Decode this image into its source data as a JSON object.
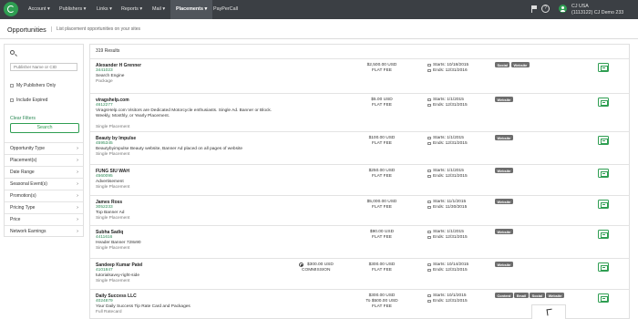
{
  "nav": {
    "items": [
      {
        "label": "Account ▾"
      },
      {
        "label": "Publishers ▾"
      },
      {
        "label": "Links ▾"
      },
      {
        "label": "Reports ▾"
      },
      {
        "label": "Mail ▾"
      },
      {
        "label": "Placements ▾"
      },
      {
        "label": "PayPerCall"
      }
    ],
    "help_glyph": "?",
    "user_name": "CJ USA",
    "user_account": "(1113122) CJ Demo 233"
  },
  "header": {
    "title": "Opportunities",
    "subtitle": "List placement opportunities on your sites"
  },
  "sidebar": {
    "search_placeholder": "Publisher Name or CID",
    "my_publishers_label": "My Publishers Only",
    "include_expired_label": "Include Expired",
    "clear_filters_label": "Clear Filters",
    "search_button_label": "Search",
    "chevron_glyph": "›",
    "filters": [
      {
        "label": "Opportunity Type"
      },
      {
        "label": "Placement(s)"
      },
      {
        "label": "Date Range"
      },
      {
        "label": "Seasonal Event(s)"
      },
      {
        "label": "Promotion(s)"
      },
      {
        "label": "Pricing Type"
      },
      {
        "label": "Price"
      },
      {
        "label": "Network Earnings"
      }
    ]
  },
  "results": {
    "count_label": "319 Results",
    "rows": [
      {
        "name": "Alexander H Grenner",
        "id": "3441023",
        "desc": "Search Engine",
        "type": "Package",
        "amount": "$2,500.00 USD",
        "fee": "FLAT FEE",
        "starts": "Starts: 10/18/2015",
        "ends": "Ends: 12/31/2016",
        "tags": [
          "Social",
          "Website"
        ]
      },
      {
        "name": "viragshelp.com",
        "id": "4612277",
        "desc": "ViragsHelp.com Visitors are Dedicated Motorcycle enthusiasts. Single Ad. Banner or Block. Weekly, Monthly, or Yearly Placement.",
        "type": "Single Placement",
        "amount": "$5.00 USD",
        "fee": "FLAT FEE",
        "starts": "Starts: 1/1/2015",
        "ends": "Ends: 12/31/2015",
        "tags": [
          "Website"
        ]
      },
      {
        "name": "Beauty by Impulse",
        "id": "4595345",
        "desc": "Beautybyimpulse Beauty website, Banner Ad placed on all pages of website",
        "type": "Single Placement",
        "amount": "$100.00 USD",
        "fee": "FLAT FEE",
        "starts": "Starts: 1/1/2015",
        "ends": "Ends: 12/31/2015",
        "tags": [
          "Website"
        ]
      },
      {
        "name": "FUNG SIU WAH",
        "id": "4560095",
        "desc": "Advertisement",
        "type": "Single Placement",
        "amount": "$250.00 USD",
        "fee": "FLAT FEE",
        "starts": "Starts: 1/1/2015",
        "ends": "Ends: 12/31/2015",
        "tags": [
          "Website"
        ]
      },
      {
        "name": "James Ross",
        "id": "3052233",
        "desc": "Top Banner Ad",
        "type": "Single Placement",
        "amount": "$5,000.00 USD",
        "fee": "FLAT FEE",
        "starts": "Starts: 11/1/2015",
        "ends": "Ends: 11/30/2015",
        "tags": [
          "Website"
        ]
      },
      {
        "name": "Subha Sadiq",
        "id": "4411616",
        "desc": "Header Banner 728x90",
        "type": "Single Placement",
        "amount": "$90.00 USD",
        "fee": "FLAT FEE",
        "starts": "Starts: 1/1/2015",
        "ends": "Ends: 12/31/2015",
        "tags": [
          "Website"
        ]
      },
      {
        "name": "Sandeep Kumar Patel",
        "id": "4101847",
        "desc": "tutorialsavvy-right-side",
        "type": "Single Placement",
        "commission_amount": "$300.00 USD",
        "commission_label": "COMMISSION",
        "amount": "$300.00 USD",
        "fee": "FLAT FEE",
        "starts": "Starts: 10/14/2015",
        "ends": "Ends: 12/31/2015",
        "tags": [
          "Website"
        ]
      },
      {
        "name": "Daily Success LLC",
        "id": "4024879",
        "desc": "Your Daily Success Tip Rate Card and Packages",
        "type": "Full Ratecard",
        "amount": "$300.00 USD",
        "fee": "To $500.00 USD",
        "fee3": "FLAT FEE",
        "starts": "Starts: 10/1/2015",
        "ends": "Ends: 12/31/2015",
        "tags": [
          "Content",
          "Email",
          "Social",
          "Website"
        ]
      }
    ]
  },
  "colors": {
    "nav_bg": "#3b3f44",
    "brand_green": "#2f9e52",
    "link_green": "#2d8a56",
    "tag_bg": "#6d6d6d"
  }
}
